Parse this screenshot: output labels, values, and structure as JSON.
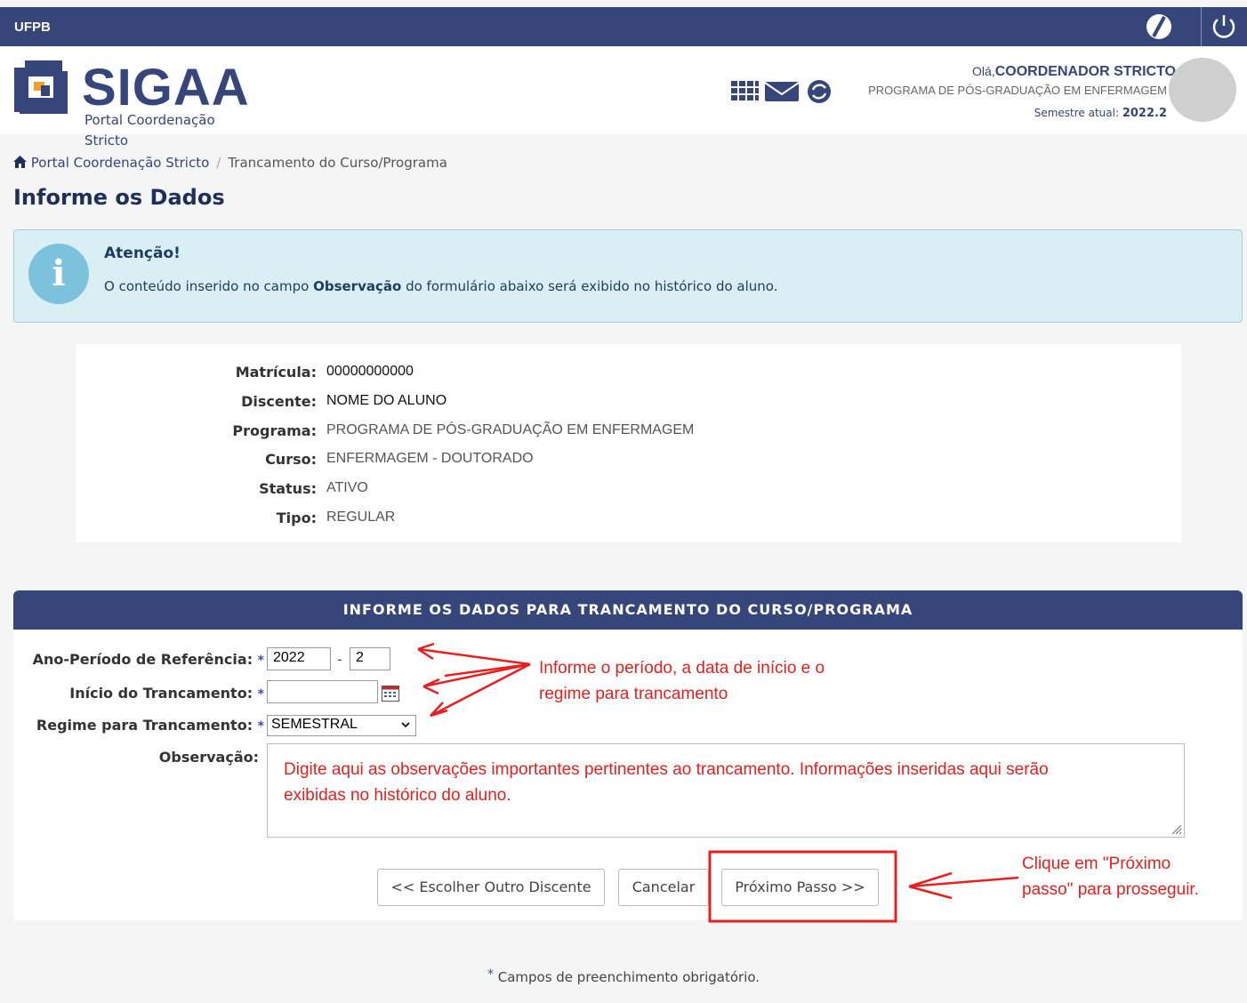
{
  "topbar": {
    "brand": "UFPB"
  },
  "header": {
    "logo_text": "SIGAA",
    "logo_sub": "Portal Coordenação Stricto",
    "hello_prefix": "Olá,",
    "user_name": "COORDENADOR STRICTO",
    "program": "PROGRAMA DE PÓS-GRADUAÇÃO EM ENFERMAGEM",
    "semester_label": "Semestre atual:",
    "semester_value": "2022.2"
  },
  "breadcrumb": {
    "home": "Portal Coordenação Stricto",
    "separator": "/",
    "current": "Trancamento do Curso/Programa"
  },
  "page_title": "Informe os Dados",
  "alert": {
    "icon_letter": "i",
    "title": "Atenção!",
    "msg_before": "O conteúdo inserido no campo ",
    "msg_bold": "Observação",
    "msg_after": " do formulário abaixo será exibido no histórico do aluno."
  },
  "student": [
    {
      "label": "Matrícula:",
      "value": "00000000000"
    },
    {
      "label": "Discente:",
      "value": "NOME DO ALUNO"
    },
    {
      "label": "Programa:",
      "value": "PROGRAMA DE PÓS-GRADUAÇÃO EM ENFERMAGEM"
    },
    {
      "label": "Curso:",
      "value": "ENFERMAGEM - DOUTORADO"
    },
    {
      "label": "Status:",
      "value": "ATIVO"
    },
    {
      "label": "Tipo:",
      "value": "REGULAR"
    }
  ],
  "form": {
    "header": "INFORME OS DADOS PARA TRANCAMENTO DO CURSO/PROGRAMA",
    "ano_label": "Ano-Período de Referência:",
    "ano_value": "2022",
    "dash": "-",
    "periodo_value": "2",
    "inicio_label": "Início do Trancamento:",
    "inicio_value": "",
    "regime_label": "Regime para Trancamento:",
    "regime_value": "SEMESTRAL",
    "obs_label": "Observação:",
    "required_star": "*"
  },
  "buttons": {
    "escolher": "<< Escolher Outro Discente",
    "cancelar": "Cancelar",
    "proximo": "Próximo Passo >>"
  },
  "annotations": {
    "note1_line1": "Informe o período, a data de início e o",
    "note1_line2": "regime para trancamento",
    "obs_line1": "Digite aqui as observações importantes pertinentes ao trancamento. Informações inseridas aqui serão",
    "obs_line2": "exibidas no histórico do aluno.",
    "note2_line1": "Clique em \"Próximo",
    "note2_line2": "passo\" para prosseguir."
  },
  "footer": {
    "star": "*",
    "text": " Campos de preenchimento obrigatório."
  },
  "colors": {
    "primary": "#37467a",
    "annotation_red": "#e5201f",
    "alert_bg": "#d9eff4"
  }
}
